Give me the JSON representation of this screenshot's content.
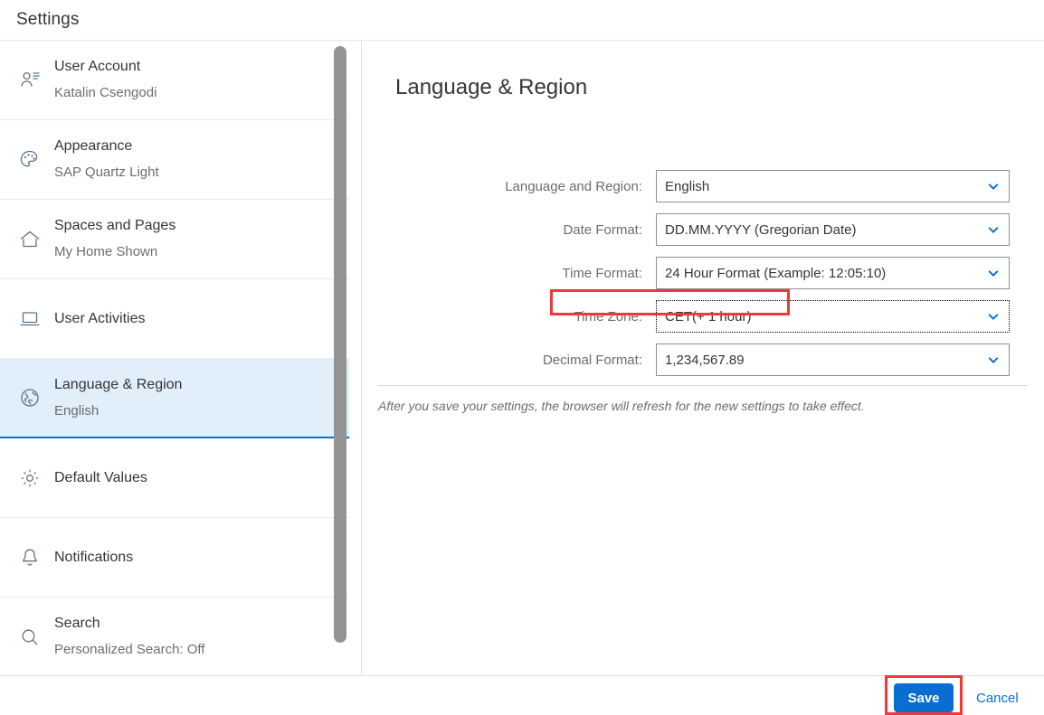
{
  "dialog": {
    "title": "Settings"
  },
  "sidebar": {
    "items": [
      {
        "label": "User Account",
        "sub": "Katalin Csengodi",
        "icon": "user-icon",
        "selected": false
      },
      {
        "label": "Appearance",
        "sub": "SAP Quartz Light",
        "icon": "palette-icon",
        "selected": false
      },
      {
        "label": "Spaces and Pages",
        "sub": "My Home Shown",
        "icon": "home-icon",
        "selected": false
      },
      {
        "label": "User Activities",
        "sub": "",
        "icon": "laptop-icon",
        "selected": false
      },
      {
        "label": "Language & Region",
        "sub": "English",
        "icon": "globe-icon",
        "selected": true
      },
      {
        "label": "Default Values",
        "sub": "",
        "icon": "gear-icon",
        "selected": false
      },
      {
        "label": "Notifications",
        "sub": "",
        "icon": "bell-icon",
        "selected": false
      },
      {
        "label": "Search",
        "sub": "Personalized Search: Off",
        "icon": "search-icon",
        "selected": false
      }
    ]
  },
  "main": {
    "page_title": "Language & Region",
    "fields": [
      {
        "label": "Language and Region:",
        "value": "English",
        "focused": false
      },
      {
        "label": "Date Format:",
        "value": "DD.MM.YYYY (Gregorian Date)",
        "focused": false
      },
      {
        "label": "Time Format:",
        "value": "24 Hour Format (Example: 12:05:10)",
        "focused": false
      },
      {
        "label": "Time Zone:",
        "value": "CET(+ 1 hour)",
        "focused": true
      },
      {
        "label": "Decimal Format:",
        "value": "1,234,567.89",
        "focused": false
      }
    ],
    "note": "After you save your settings, the browser will refresh for the new settings to take effect."
  },
  "footer": {
    "save_label": "Save",
    "cancel_label": "Cancel"
  },
  "colors": {
    "accent": "#0a6ed1",
    "selected_bg": "#e1effa",
    "annotation": "#f0383a",
    "text": "#32363a",
    "muted_text": "#6a6d70"
  }
}
